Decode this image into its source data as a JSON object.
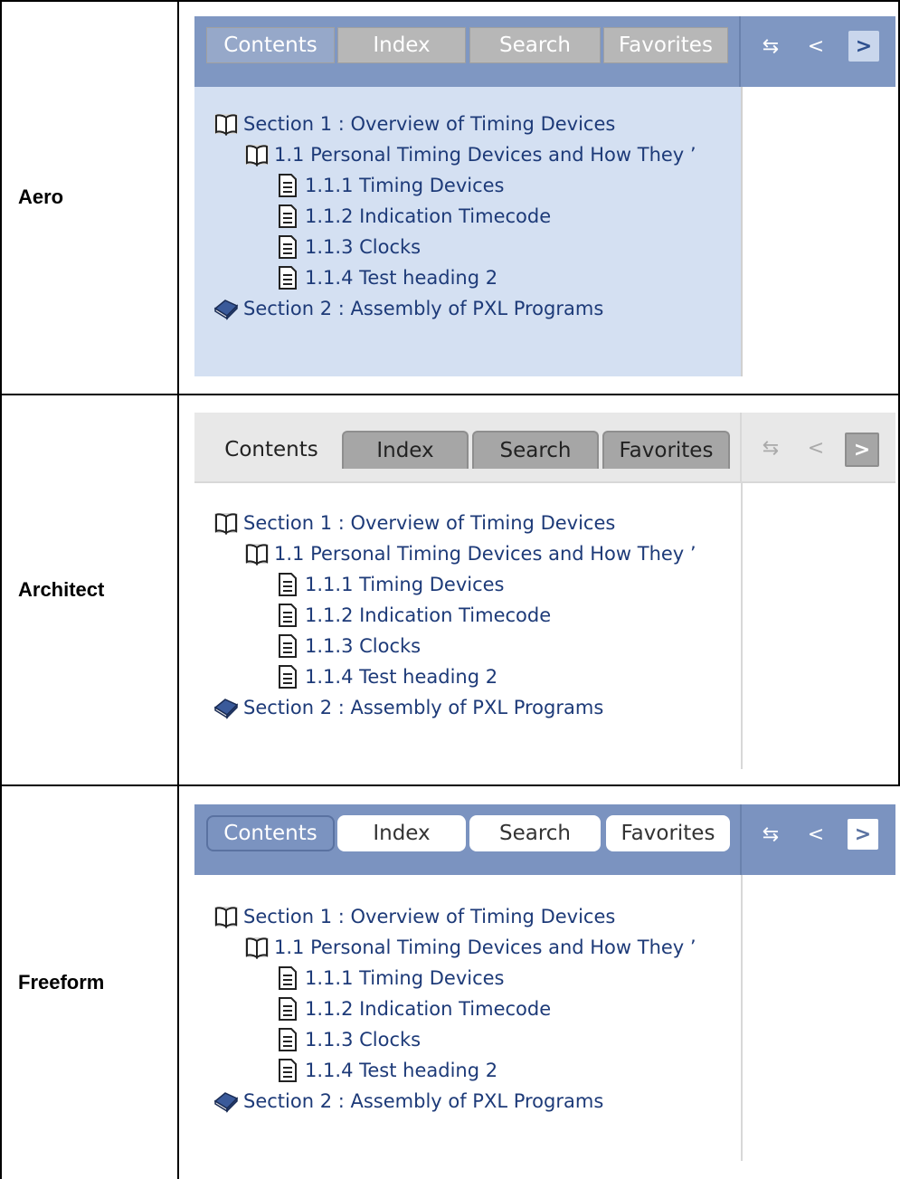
{
  "rows": [
    {
      "theme_name": "Aero",
      "tabs": [
        "Contents",
        "Index",
        "Search",
        "Favorites"
      ],
      "active_tab": "Contents",
      "nav_icons": [
        "sync-icon",
        "back-icon",
        "forward-icon"
      ],
      "tree": [
        {
          "level": 0,
          "icon": "book-open-icon",
          "label": "Section 1 : Overview of Timing Devices"
        },
        {
          "level": 1,
          "icon": "book-open-icon",
          "label": "1.1 Personal Timing Devices and How They ’"
        },
        {
          "level": 2,
          "icon": "document-icon",
          "label": "1.1.1 Timing Devices"
        },
        {
          "level": 2,
          "icon": "document-icon",
          "label": "1.1.2 Indication Timecode"
        },
        {
          "level": 2,
          "icon": "document-icon",
          "label": "1.1.3 Clocks"
        },
        {
          "level": 2,
          "icon": "document-icon",
          "label": "1.1.4 Test heading 2"
        },
        {
          "level": 0,
          "icon": "book-closed-icon",
          "label": "Section 2 : Assembly of PXL Programs"
        }
      ]
    },
    {
      "theme_name": "Architect",
      "tabs": [
        "Contents",
        "Index",
        "Search",
        "Favorites"
      ],
      "active_tab": "Contents",
      "nav_icons": [
        "sync-icon",
        "back-icon",
        "forward-icon"
      ],
      "tree": [
        {
          "level": 0,
          "icon": "book-open-icon",
          "label": "Section 1 : Overview of Timing Devices"
        },
        {
          "level": 1,
          "icon": "book-open-icon",
          "label": "1.1 Personal Timing Devices and How They ’"
        },
        {
          "level": 2,
          "icon": "document-icon",
          "label": "1.1.1 Timing Devices"
        },
        {
          "level": 2,
          "icon": "document-icon",
          "label": "1.1.2 Indication Timecode"
        },
        {
          "level": 2,
          "icon": "document-icon",
          "label": "1.1.3 Clocks"
        },
        {
          "level": 2,
          "icon": "document-icon",
          "label": "1.1.4 Test heading 2"
        },
        {
          "level": 0,
          "icon": "book-closed-icon",
          "label": "Section 2 : Assembly of PXL Programs"
        }
      ]
    },
    {
      "theme_name": "Freeform",
      "tabs": [
        "Contents",
        "Index",
        "Search",
        "Favorites"
      ],
      "active_tab": "Contents",
      "nav_icons": [
        "sync-icon",
        "back-icon",
        "forward-icon"
      ],
      "tree": [
        {
          "level": 0,
          "icon": "book-open-icon",
          "label": "Section 1 : Overview of Timing Devices"
        },
        {
          "level": 1,
          "icon": "book-open-icon",
          "label": "1.1 Personal Timing Devices and How They ’"
        },
        {
          "level": 2,
          "icon": "document-icon",
          "label": "1.1.1 Timing Devices"
        },
        {
          "level": 2,
          "icon": "document-icon",
          "label": "1.1.2 Indication Timecode"
        },
        {
          "level": 2,
          "icon": "document-icon",
          "label": "1.1.3 Clocks"
        },
        {
          "level": 2,
          "icon": "document-icon",
          "label": "1.1.4 Test heading 2"
        },
        {
          "level": 0,
          "icon": "book-closed-icon",
          "label": "Section 2 : Assembly of PXL Programs"
        }
      ]
    }
  ],
  "colors": {
    "aero_panel": "#d4e0f2",
    "aero_toolbar": "#7f97c2",
    "architect_toolbar": "#e8e8e8",
    "freeform_toolbar": "#7b93c0",
    "tree_text": "#1d3a78"
  }
}
